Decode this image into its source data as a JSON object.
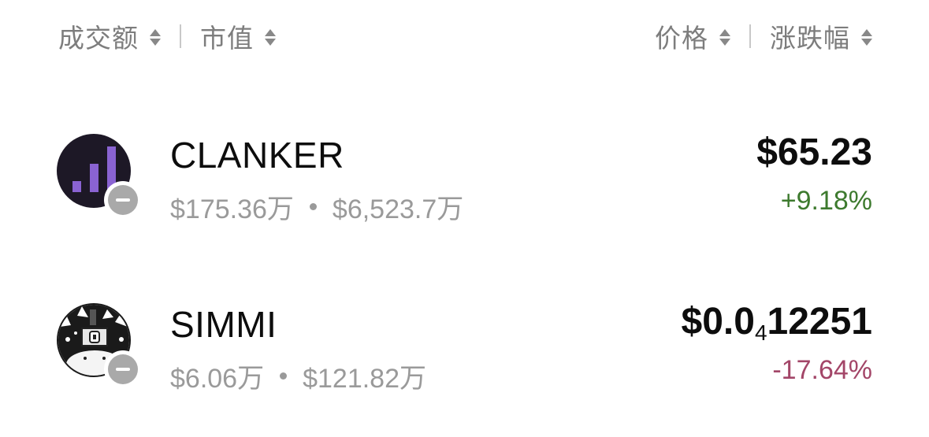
{
  "header": {
    "left": [
      {
        "label": "成交额"
      },
      {
        "label": "市值"
      }
    ],
    "right": [
      {
        "label": "价格"
      },
      {
        "label": "涨跌幅"
      }
    ]
  },
  "colors": {
    "positive": "#3d7a2e",
    "negative": "#a34668",
    "muted": "#9a9a9a",
    "header_text": "#7d7d7d"
  },
  "tokens": [
    {
      "symbol": "CLANKER",
      "volume": "$175.36万",
      "market_cap": "$6,523.7万",
      "price": "$65.23",
      "change": "+9.18%",
      "direction": "up",
      "avatar_icon": "clanker-bars-icon",
      "chain_icon": "chain-badge-icon"
    },
    {
      "symbol": "SIMMI",
      "volume": "$6.06万",
      "market_cap": "$121.82万",
      "price_prefix": "$0.0",
      "price_zero_count": "4",
      "price_digits": "12251",
      "change": "-17.64%",
      "direction": "down",
      "avatar_icon": "simmi-cat-icon",
      "chain_icon": "chain-badge-icon"
    }
  ]
}
